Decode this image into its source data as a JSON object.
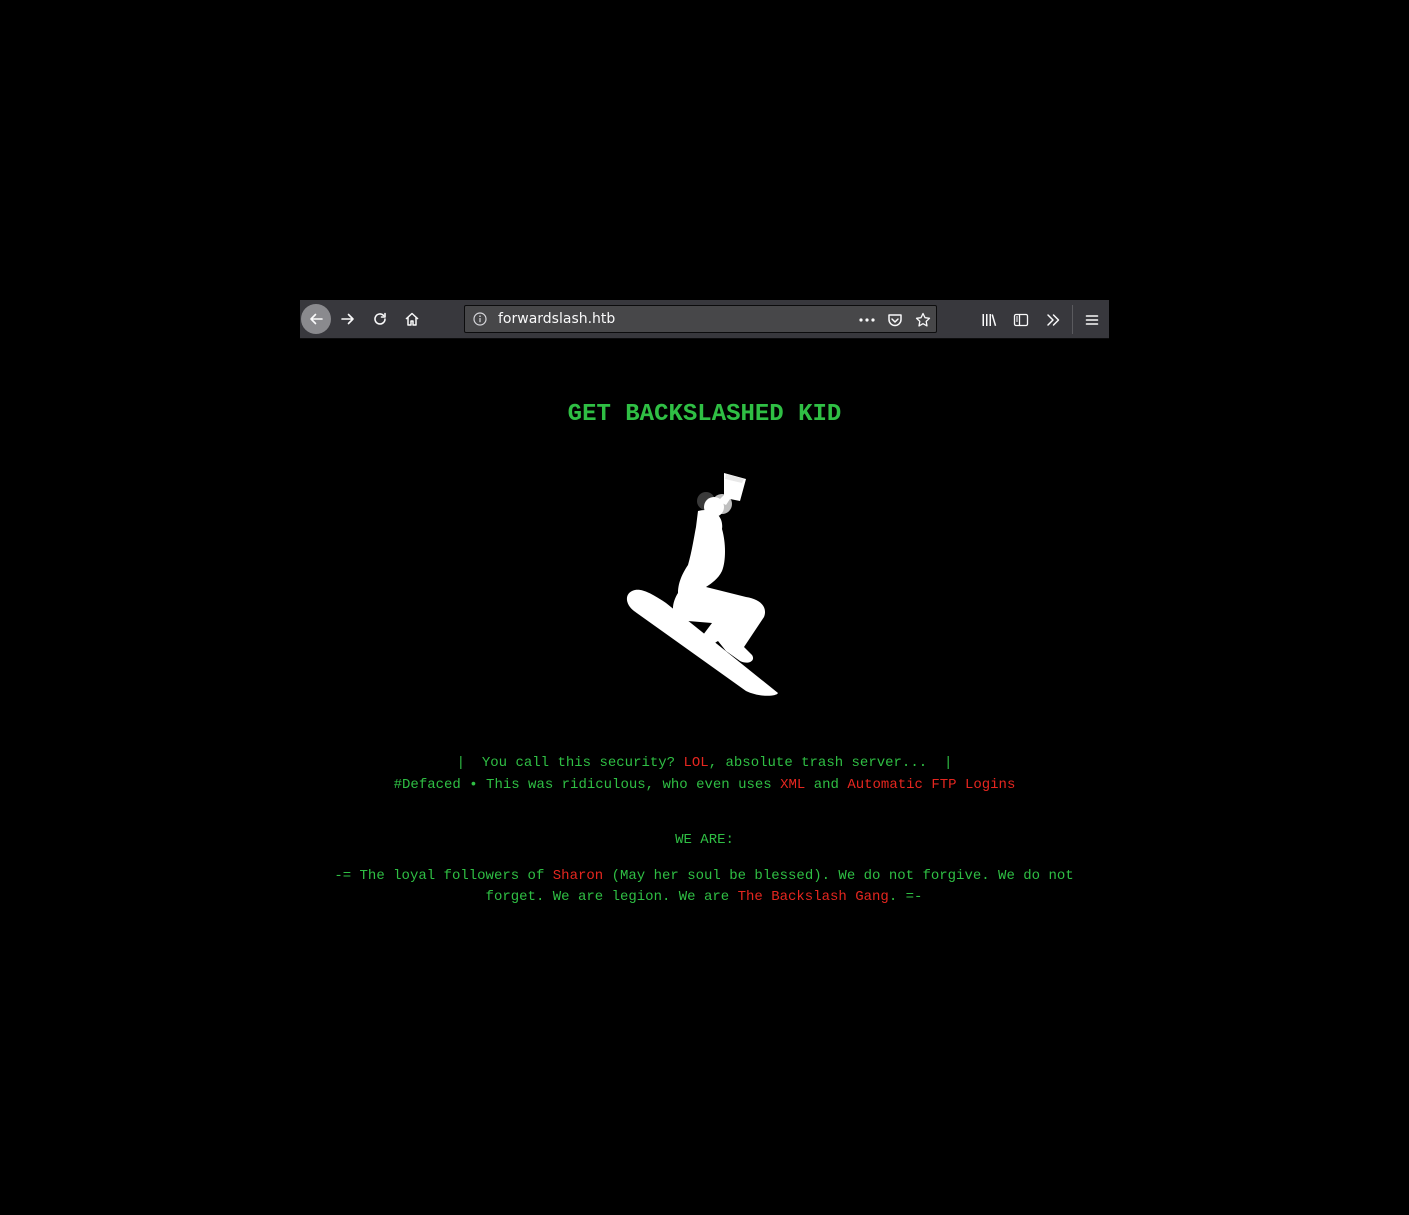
{
  "browser": {
    "url": "forwardslash.htb",
    "icons": {
      "back": "arrow-left-icon",
      "forward": "arrow-right-icon",
      "reload": "reload-icon",
      "home": "home-icon",
      "info": "info-icon",
      "page_actions": "more-horizontal-icon",
      "pocket": "pocket-icon",
      "bookmark": "star-icon",
      "library": "library-icon",
      "sidebar": "sidebar-icon",
      "overflow": "chevron-double-right-icon",
      "menu": "hamburger-menu-icon"
    }
  },
  "page": {
    "title": "GET BACKSLASHED KID",
    "line1": {
      "pre": "|  You call this security? ",
      "red": "LOL",
      "post": ", absolute trash server...  |"
    },
    "line2": {
      "pre": "#Defaced • This was ridiculous, who even uses ",
      "red1": "XML",
      "mid": " and ",
      "red2": "Automatic FTP Logins"
    },
    "line3": "WE ARE:",
    "line4": {
      "pre": "-= The loyal followers of ",
      "red1": "Sharon",
      "mid": " (May her soul be blessed). We do not forgive. We do not forget. We are legion. We are ",
      "red2": "The Backslash Gang",
      "post": ". =-"
    },
    "colors": {
      "green": "#2fbf44",
      "red": "#e5261f",
      "background": "#000000"
    }
  }
}
